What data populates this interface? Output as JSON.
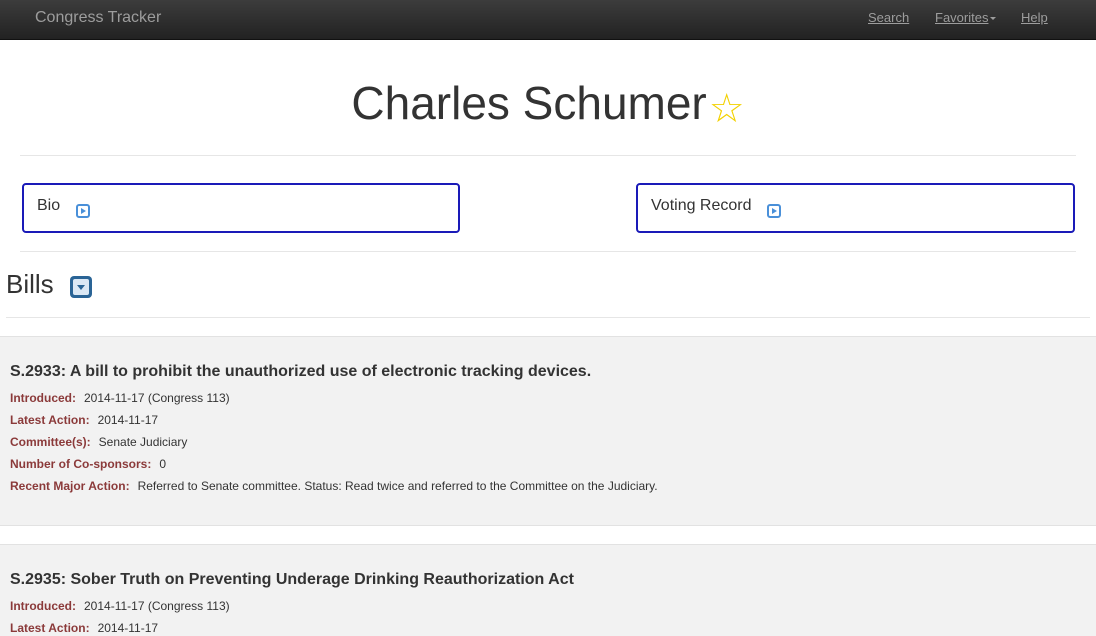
{
  "nav": {
    "brand": "Congress Tracker",
    "search": "Search",
    "favorites": "Favorites",
    "help": "Help"
  },
  "member": {
    "name": "Charles Schumer",
    "star": "☆"
  },
  "sections": {
    "bio": "Bio",
    "voting_record": "Voting Record",
    "bills": "Bills"
  },
  "labels": {
    "introduced": "Introduced:",
    "latest_action": "Latest Action:",
    "committees": "Committee(s):",
    "cosponsors": "Number of Co-sponsors:",
    "recent_major_action": "Recent Major Action:"
  },
  "bills": [
    {
      "title": "S.2933: A bill to prohibit the unauthorized use of electronic tracking devices.",
      "introduced": "2014-11-17 (Congress 113)",
      "latest_action": "2014-11-17",
      "committees": "Senate Judiciary",
      "cosponsors": "0",
      "recent_major_action": "Referred to Senate committee. Status: Read twice and referred to the Committee on the Judiciary."
    },
    {
      "title": "S.2935: Sober Truth on Preventing Underage Drinking Reauthorization Act",
      "introduced": "2014-11-17 (Congress 113)",
      "latest_action": "2014-11-17"
    }
  ]
}
